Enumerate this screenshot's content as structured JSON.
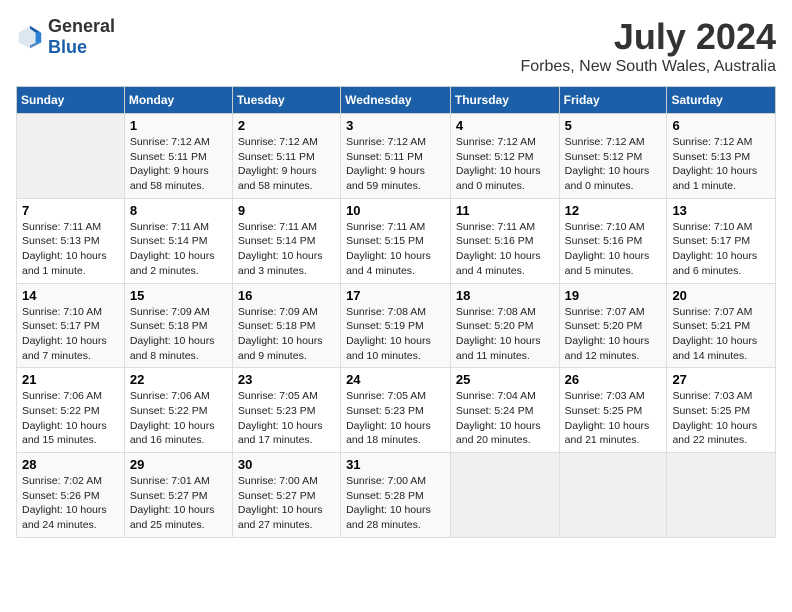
{
  "header": {
    "logo_general": "General",
    "logo_blue": "Blue",
    "title": "July 2024",
    "subtitle": "Forbes, New South Wales, Australia"
  },
  "calendar": {
    "days_of_week": [
      "Sunday",
      "Monday",
      "Tuesday",
      "Wednesday",
      "Thursday",
      "Friday",
      "Saturday"
    ],
    "weeks": [
      [
        {
          "day": "",
          "sunrise": "",
          "sunset": "",
          "daylight": "",
          "empty": true
        },
        {
          "day": "1",
          "sunrise": "Sunrise: 7:12 AM",
          "sunset": "Sunset: 5:11 PM",
          "daylight": "Daylight: 9 hours and 58 minutes."
        },
        {
          "day": "2",
          "sunrise": "Sunrise: 7:12 AM",
          "sunset": "Sunset: 5:11 PM",
          "daylight": "Daylight: 9 hours and 58 minutes."
        },
        {
          "day": "3",
          "sunrise": "Sunrise: 7:12 AM",
          "sunset": "Sunset: 5:11 PM",
          "daylight": "Daylight: 9 hours and 59 minutes."
        },
        {
          "day": "4",
          "sunrise": "Sunrise: 7:12 AM",
          "sunset": "Sunset: 5:12 PM",
          "daylight": "Daylight: 10 hours and 0 minutes."
        },
        {
          "day": "5",
          "sunrise": "Sunrise: 7:12 AM",
          "sunset": "Sunset: 5:12 PM",
          "daylight": "Daylight: 10 hours and 0 minutes."
        },
        {
          "day": "6",
          "sunrise": "Sunrise: 7:12 AM",
          "sunset": "Sunset: 5:13 PM",
          "daylight": "Daylight: 10 hours and 1 minute."
        }
      ],
      [
        {
          "day": "7",
          "sunrise": "Sunrise: 7:11 AM",
          "sunset": "Sunset: 5:13 PM",
          "daylight": "Daylight: 10 hours and 1 minute."
        },
        {
          "day": "8",
          "sunrise": "Sunrise: 7:11 AM",
          "sunset": "Sunset: 5:14 PM",
          "daylight": "Daylight: 10 hours and 2 minutes."
        },
        {
          "day": "9",
          "sunrise": "Sunrise: 7:11 AM",
          "sunset": "Sunset: 5:14 PM",
          "daylight": "Daylight: 10 hours and 3 minutes."
        },
        {
          "day": "10",
          "sunrise": "Sunrise: 7:11 AM",
          "sunset": "Sunset: 5:15 PM",
          "daylight": "Daylight: 10 hours and 4 minutes."
        },
        {
          "day": "11",
          "sunrise": "Sunrise: 7:11 AM",
          "sunset": "Sunset: 5:16 PM",
          "daylight": "Daylight: 10 hours and 4 minutes."
        },
        {
          "day": "12",
          "sunrise": "Sunrise: 7:10 AM",
          "sunset": "Sunset: 5:16 PM",
          "daylight": "Daylight: 10 hours and 5 minutes."
        },
        {
          "day": "13",
          "sunrise": "Sunrise: 7:10 AM",
          "sunset": "Sunset: 5:17 PM",
          "daylight": "Daylight: 10 hours and 6 minutes."
        }
      ],
      [
        {
          "day": "14",
          "sunrise": "Sunrise: 7:10 AM",
          "sunset": "Sunset: 5:17 PM",
          "daylight": "Daylight: 10 hours and 7 minutes."
        },
        {
          "day": "15",
          "sunrise": "Sunrise: 7:09 AM",
          "sunset": "Sunset: 5:18 PM",
          "daylight": "Daylight: 10 hours and 8 minutes."
        },
        {
          "day": "16",
          "sunrise": "Sunrise: 7:09 AM",
          "sunset": "Sunset: 5:18 PM",
          "daylight": "Daylight: 10 hours and 9 minutes."
        },
        {
          "day": "17",
          "sunrise": "Sunrise: 7:08 AM",
          "sunset": "Sunset: 5:19 PM",
          "daylight": "Daylight: 10 hours and 10 minutes."
        },
        {
          "day": "18",
          "sunrise": "Sunrise: 7:08 AM",
          "sunset": "Sunset: 5:20 PM",
          "daylight": "Daylight: 10 hours and 11 minutes."
        },
        {
          "day": "19",
          "sunrise": "Sunrise: 7:07 AM",
          "sunset": "Sunset: 5:20 PM",
          "daylight": "Daylight: 10 hours and 12 minutes."
        },
        {
          "day": "20",
          "sunrise": "Sunrise: 7:07 AM",
          "sunset": "Sunset: 5:21 PM",
          "daylight": "Daylight: 10 hours and 14 minutes."
        }
      ],
      [
        {
          "day": "21",
          "sunrise": "Sunrise: 7:06 AM",
          "sunset": "Sunset: 5:22 PM",
          "daylight": "Daylight: 10 hours and 15 minutes."
        },
        {
          "day": "22",
          "sunrise": "Sunrise: 7:06 AM",
          "sunset": "Sunset: 5:22 PM",
          "daylight": "Daylight: 10 hours and 16 minutes."
        },
        {
          "day": "23",
          "sunrise": "Sunrise: 7:05 AM",
          "sunset": "Sunset: 5:23 PM",
          "daylight": "Daylight: 10 hours and 17 minutes."
        },
        {
          "day": "24",
          "sunrise": "Sunrise: 7:05 AM",
          "sunset": "Sunset: 5:23 PM",
          "daylight": "Daylight: 10 hours and 18 minutes."
        },
        {
          "day": "25",
          "sunrise": "Sunrise: 7:04 AM",
          "sunset": "Sunset: 5:24 PM",
          "daylight": "Daylight: 10 hours and 20 minutes."
        },
        {
          "day": "26",
          "sunrise": "Sunrise: 7:03 AM",
          "sunset": "Sunset: 5:25 PM",
          "daylight": "Daylight: 10 hours and 21 minutes."
        },
        {
          "day": "27",
          "sunrise": "Sunrise: 7:03 AM",
          "sunset": "Sunset: 5:25 PM",
          "daylight": "Daylight: 10 hours and 22 minutes."
        }
      ],
      [
        {
          "day": "28",
          "sunrise": "Sunrise: 7:02 AM",
          "sunset": "Sunset: 5:26 PM",
          "daylight": "Daylight: 10 hours and 24 minutes."
        },
        {
          "day": "29",
          "sunrise": "Sunrise: 7:01 AM",
          "sunset": "Sunset: 5:27 PM",
          "daylight": "Daylight: 10 hours and 25 minutes."
        },
        {
          "day": "30",
          "sunrise": "Sunrise: 7:00 AM",
          "sunset": "Sunset: 5:27 PM",
          "daylight": "Daylight: 10 hours and 27 minutes."
        },
        {
          "day": "31",
          "sunrise": "Sunrise: 7:00 AM",
          "sunset": "Sunset: 5:28 PM",
          "daylight": "Daylight: 10 hours and 28 minutes."
        },
        {
          "day": "",
          "sunrise": "",
          "sunset": "",
          "daylight": "",
          "empty": true
        },
        {
          "day": "",
          "sunrise": "",
          "sunset": "",
          "daylight": "",
          "empty": true
        },
        {
          "day": "",
          "sunrise": "",
          "sunset": "",
          "daylight": "",
          "empty": true
        }
      ]
    ]
  }
}
